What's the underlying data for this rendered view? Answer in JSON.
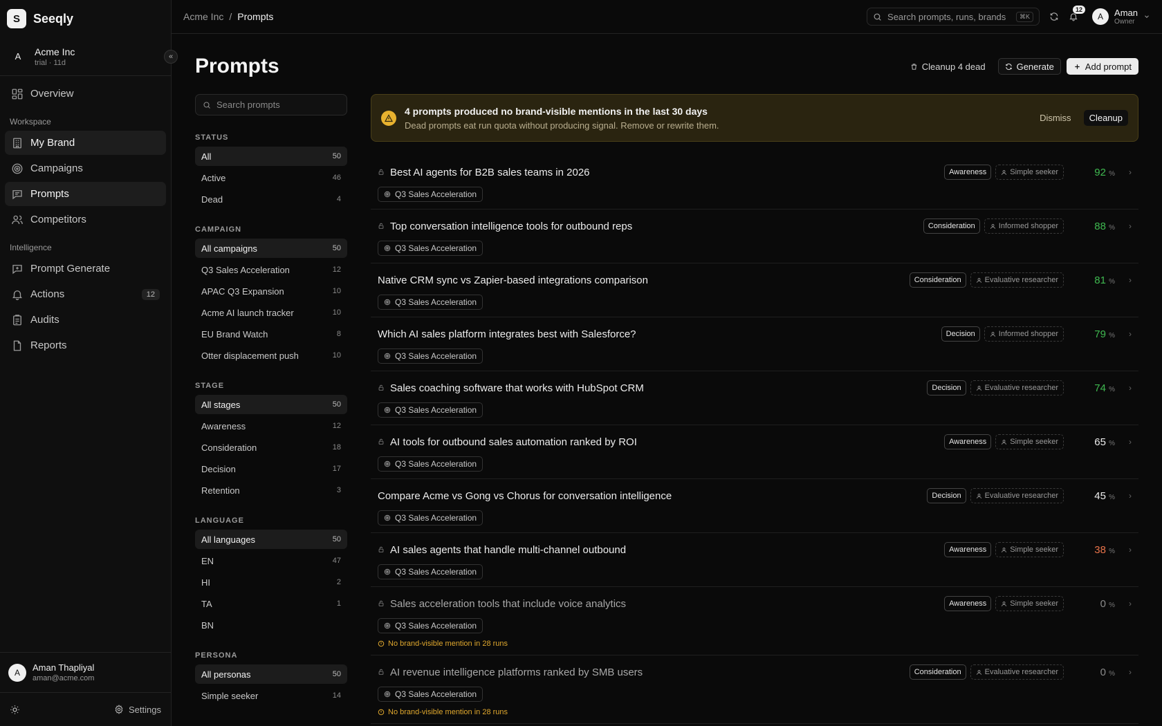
{
  "brand": {
    "logo_letter": "S",
    "name": "Seeqly"
  },
  "org": {
    "avatar": "A",
    "name": "Acme Inc",
    "meta": "trial · 11d",
    "collapse_icon": "chevrons-left-icon"
  },
  "nav_primary": [
    {
      "label": "Overview",
      "icon": "grid-icon"
    }
  ],
  "workspace": {
    "label": "Workspace",
    "items": [
      {
        "label": "My Brand",
        "icon": "building-icon",
        "active": true
      },
      {
        "label": "Campaigns",
        "icon": "target-icon"
      },
      {
        "label": "Prompts",
        "icon": "message-icon",
        "active": true
      },
      {
        "label": "Competitors",
        "icon": "users-icon"
      }
    ]
  },
  "intelligence": {
    "label": "Intelligence",
    "items": [
      {
        "label": "Prompt Generate",
        "icon": "message-plus-icon"
      },
      {
        "label": "Actions",
        "icon": "bell-icon",
        "badge": "12"
      },
      {
        "label": "Audits",
        "icon": "clipboard-icon"
      },
      {
        "label": "Reports",
        "icon": "file-icon"
      }
    ]
  },
  "user": {
    "avatar": "A",
    "name": "Aman Thapliyal",
    "email": "aman@acme.com"
  },
  "footer": {
    "settings_label": "Settings"
  },
  "topbar": {
    "breadcrumb": {
      "root": "Acme Inc",
      "sep": "/",
      "current": "Prompts"
    },
    "search_placeholder": "Search prompts, runs, brands",
    "search_kbd": "⌘K",
    "notifications": "12",
    "me": {
      "avatar": "A",
      "name": "Aman",
      "role": "Owner"
    }
  },
  "page": {
    "title": "Prompts",
    "actions": {
      "cleanup": "Cleanup 4 dead",
      "generate": "Generate",
      "add": "Add prompt"
    }
  },
  "filters": {
    "search_placeholder": "Search prompts",
    "sections": [
      {
        "title": "STATUS",
        "items": [
          {
            "label": "All",
            "count": "50",
            "selected": true
          },
          {
            "label": "Active",
            "count": "46"
          },
          {
            "label": "Dead",
            "count": "4"
          }
        ]
      },
      {
        "title": "CAMPAIGN",
        "items": [
          {
            "label": "All campaigns",
            "count": "50",
            "selected": true
          },
          {
            "label": "Q3 Sales Acceleration",
            "count": "12"
          },
          {
            "label": "APAC Q3 Expansion",
            "count": "10"
          },
          {
            "label": "Acme AI launch tracker",
            "count": "10"
          },
          {
            "label": "EU Brand Watch",
            "count": "8"
          },
          {
            "label": "Otter displacement push",
            "count": "10"
          }
        ]
      },
      {
        "title": "STAGE",
        "items": [
          {
            "label": "All stages",
            "count": "50",
            "selected": true
          },
          {
            "label": "Awareness",
            "count": "12"
          },
          {
            "label": "Consideration",
            "count": "18"
          },
          {
            "label": "Decision",
            "count": "17"
          },
          {
            "label": "Retention",
            "count": "3"
          }
        ]
      },
      {
        "title": "LANGUAGE",
        "items": [
          {
            "label": "All languages",
            "count": "50",
            "selected": true
          },
          {
            "label": "EN",
            "count": "47"
          },
          {
            "label": "HI",
            "count": "2"
          },
          {
            "label": "TA",
            "count": "1"
          },
          {
            "label": "BN",
            "count": ""
          }
        ]
      },
      {
        "title": "PERSONA",
        "items": [
          {
            "label": "All personas",
            "count": "50",
            "selected": true
          },
          {
            "label": "Simple seeker",
            "count": "14"
          }
        ]
      }
    ]
  },
  "alert": {
    "title": "4 prompts produced no brand-visible mentions in the last 30 days",
    "subtitle": "Dead prompts eat run quota without producing signal. Remove or rewrite them.",
    "dismiss": "Dismiss",
    "cleanup": "Cleanup"
  },
  "prompts": [
    {
      "text": "Best AI agents for B2B sales teams in 2026",
      "lock": true,
      "stage": "Awareness",
      "persona": "Simple seeker",
      "score": "92",
      "color": "#3fb950",
      "campaign": "Q3 Sales Acceleration"
    },
    {
      "text": "Top conversation intelligence tools for outbound reps",
      "lock": true,
      "stage": "Consideration",
      "persona": "Informed shopper",
      "score": "88",
      "color": "#3fb950",
      "campaign": "Q3 Sales Acceleration"
    },
    {
      "text": "Native CRM sync vs Zapier-based integrations comparison",
      "lock": false,
      "stage": "Consideration",
      "persona": "Evaluative researcher",
      "score": "81",
      "color": "#3fb950",
      "campaign": "Q3 Sales Acceleration"
    },
    {
      "text": "Which AI sales platform integrates best with Salesforce?",
      "lock": false,
      "stage": "Decision",
      "persona": "Informed shopper",
      "score": "79",
      "color": "#3fb950",
      "campaign": "Q3 Sales Acceleration"
    },
    {
      "text": "Sales coaching software that works with HubSpot CRM",
      "lock": true,
      "stage": "Decision",
      "persona": "Evaluative researcher",
      "score": "74",
      "color": "#3fb950",
      "campaign": "Q3 Sales Acceleration"
    },
    {
      "text": "AI tools for outbound sales automation ranked by ROI",
      "lock": true,
      "stage": "Awareness",
      "persona": "Simple seeker",
      "score": "65",
      "color": "#ededed",
      "campaign": "Q3 Sales Acceleration"
    },
    {
      "text": "Compare Acme vs Gong vs Chorus for conversation intelligence",
      "lock": false,
      "stage": "Decision",
      "persona": "Evaluative researcher",
      "score": "45",
      "color": "#ededed",
      "campaign": "Q3 Sales Acceleration"
    },
    {
      "text": "AI sales agents that handle multi-channel outbound",
      "lock": true,
      "stage": "Awareness",
      "persona": "Simple seeker",
      "score": "38",
      "color": "#e8734a",
      "campaign": "Q3 Sales Acceleration"
    },
    {
      "text": "Sales acceleration tools that include voice analytics",
      "lock": true,
      "dim": true,
      "stage": "Awareness",
      "persona": "Simple seeker",
      "score": "0",
      "color": "#8a8a8a",
      "campaign": "Q3 Sales Acceleration",
      "warning": "No brand-visible mention in 28 runs"
    },
    {
      "text": "AI revenue intelligence platforms ranked by SMB users",
      "lock": true,
      "dim": true,
      "stage": "Consideration",
      "persona": "Evaluative researcher",
      "score": "0",
      "color": "#8a8a8a",
      "campaign": "Q3 Sales Acceleration",
      "warning": "No brand-visible mention in 28 runs"
    }
  ],
  "score_unit": "%"
}
